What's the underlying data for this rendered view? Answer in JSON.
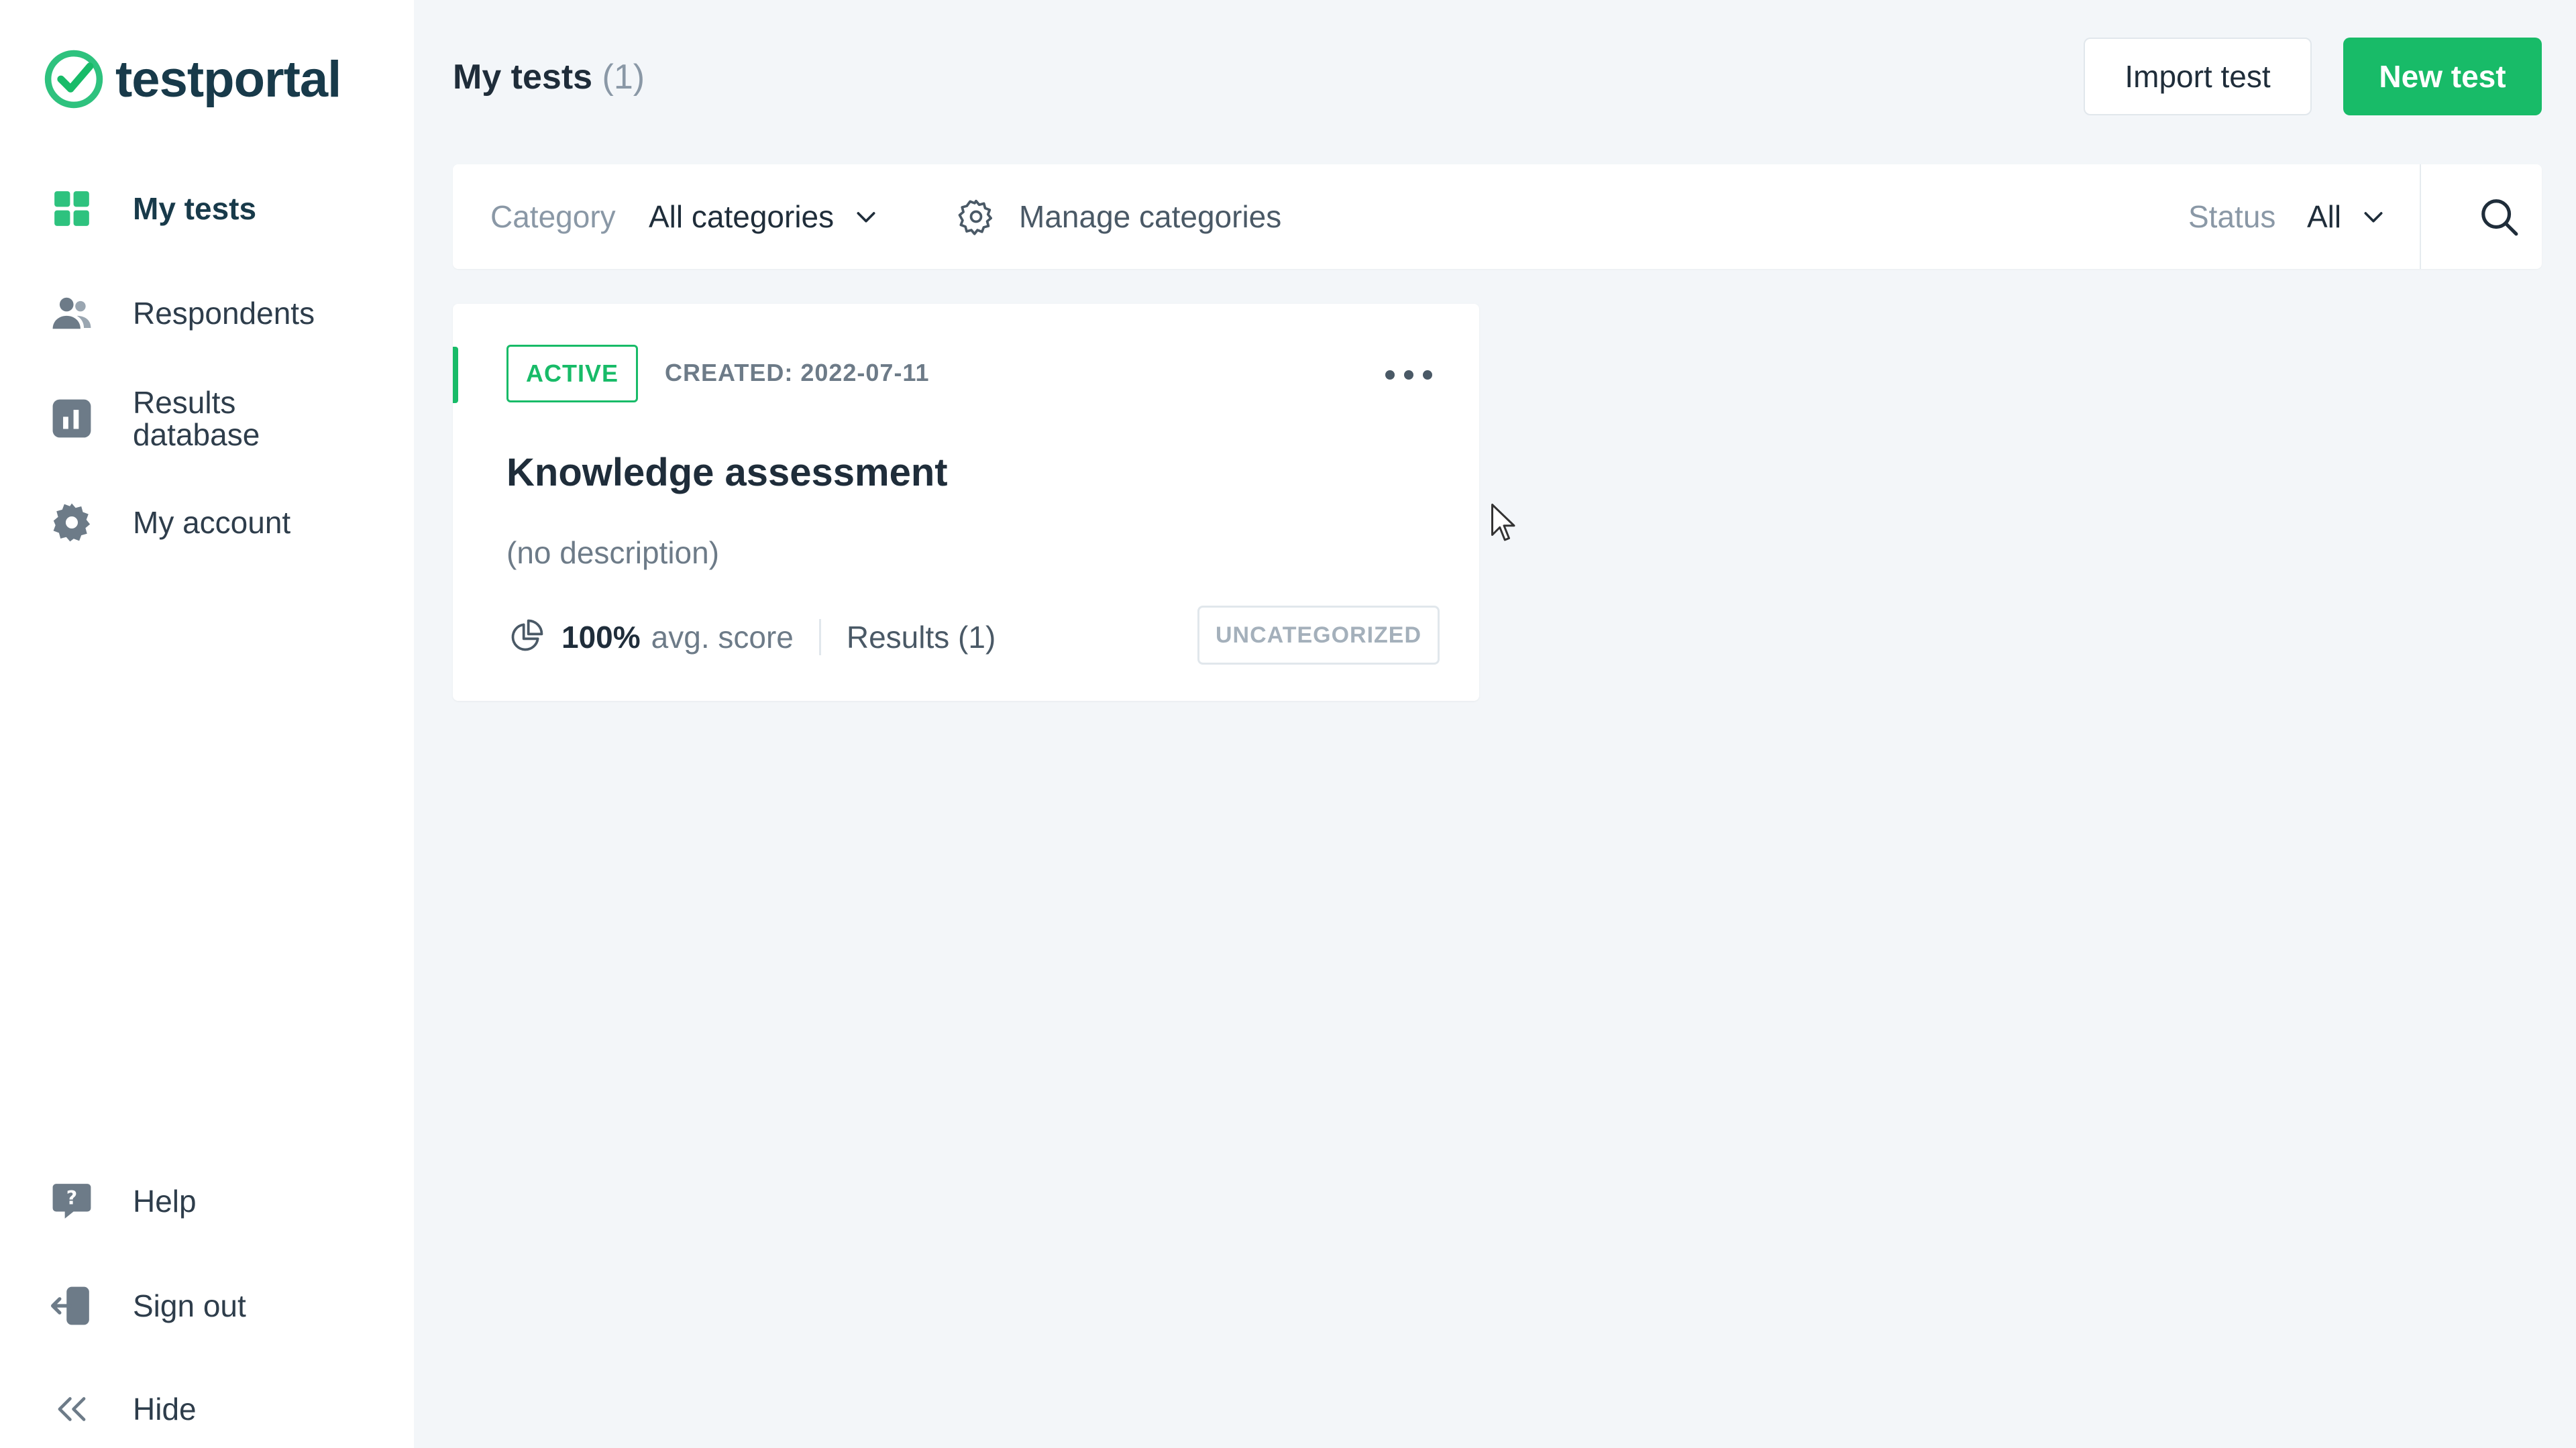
{
  "brand": {
    "name": "testportal",
    "color": "#18bb68"
  },
  "sidebar": {
    "items": [
      {
        "label": "My tests",
        "icon": "grid-icon",
        "active": true
      },
      {
        "label": "Respondents",
        "icon": "users-icon",
        "active": false
      },
      {
        "label": "Results database",
        "icon": "bar-chart-icon",
        "active": false
      },
      {
        "label": "My account",
        "icon": "gear-icon",
        "active": false
      }
    ],
    "bottom": [
      {
        "label": "Help",
        "icon": "help-bubble-icon"
      },
      {
        "label": "Sign out",
        "icon": "sign-out-icon"
      },
      {
        "label": "Hide",
        "icon": "double-chevron-left-icon"
      }
    ]
  },
  "header": {
    "title": "My tests",
    "count": "(1)",
    "import_label": "Import test",
    "new_label": "New test"
  },
  "filters": {
    "category_label": "Category",
    "category_value": "All categories",
    "manage_label": "Manage categories",
    "status_label": "Status",
    "status_value": "All"
  },
  "tests": [
    {
      "status": "ACTIVE",
      "created": "CREATED: 2022-07-11",
      "title": "Knowledge assessment",
      "description": "(no description)",
      "avg_score": "100%",
      "avg_score_label": "avg. score",
      "results": "Results (1)",
      "category": "UNCATEGORIZED"
    }
  ]
}
